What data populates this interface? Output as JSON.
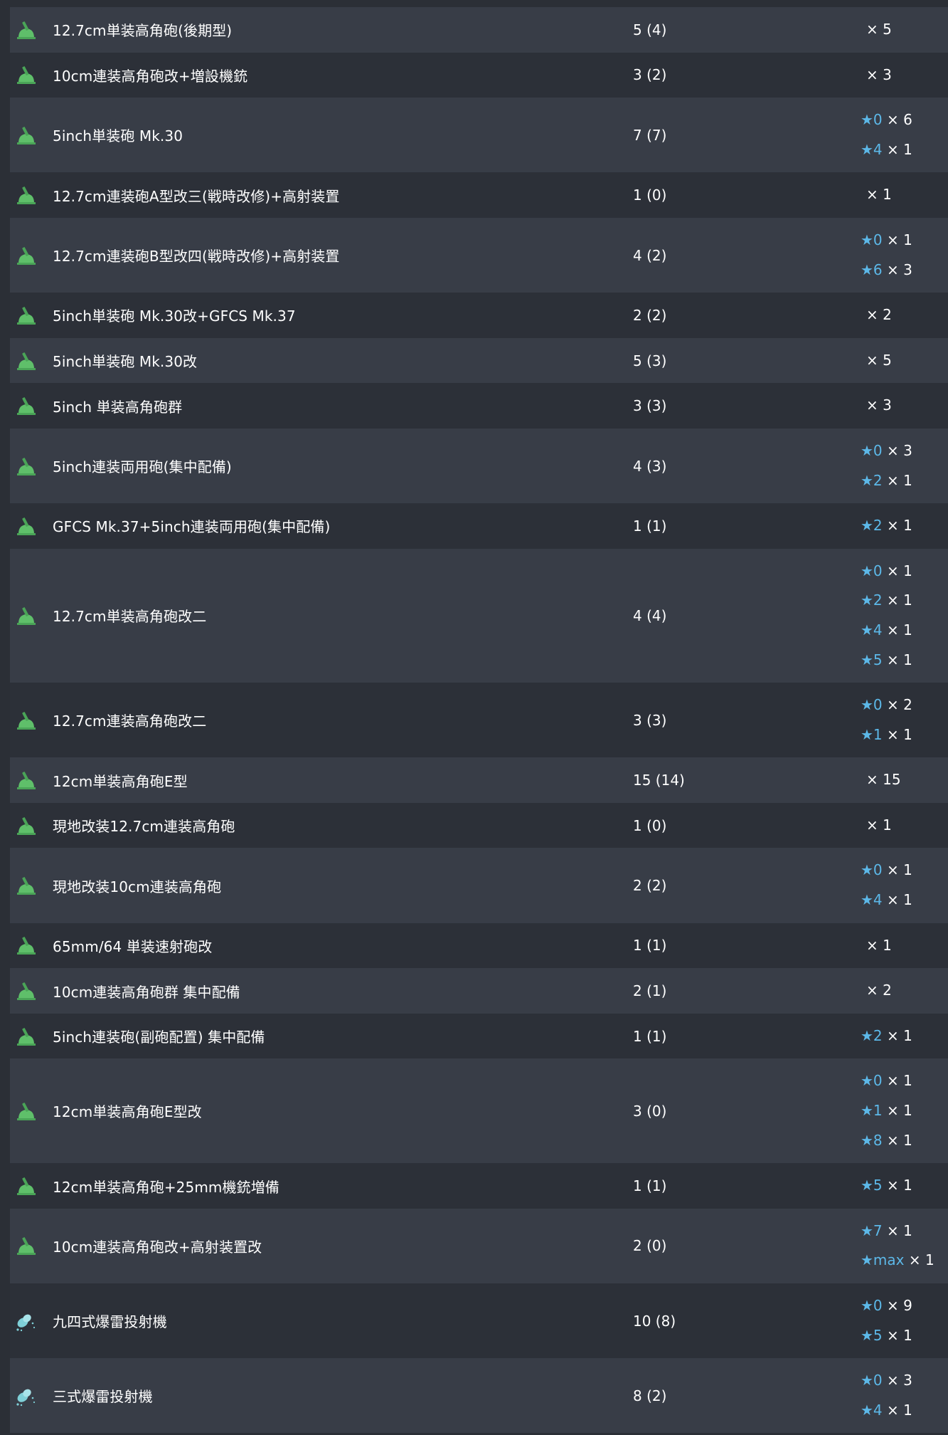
{
  "colors": {
    "row_odd": "#383d47",
    "row_even": "#2c3038",
    "star_blue": "#5cb8e8",
    "gun_icon_green": "#5fbf6a",
    "torpedo_icon_cyan": "#7fd0d8"
  },
  "rows": [
    {
      "icon": "gun-icon",
      "name": "12.7cm単装高角砲(後期型)",
      "count": "5 (4)",
      "stars": [
        {
          "level": "",
          "times": "× 5"
        }
      ]
    },
    {
      "icon": "gun-icon",
      "name": "10cm連装高角砲改+増設機銃",
      "count": "3 (2)",
      "stars": [
        {
          "level": "",
          "times": "× 3"
        }
      ]
    },
    {
      "icon": "gun-icon",
      "name": "5inch単装砲 Mk.30",
      "count": "7 (7)",
      "stars": [
        {
          "level": "★0",
          "times": " × 6"
        },
        {
          "level": "★4",
          "times": " × 1"
        }
      ]
    },
    {
      "icon": "gun-icon",
      "name": "12.7cm連装砲A型改三(戦時改修)+高射装置",
      "count": "1 (0)",
      "stars": [
        {
          "level": "",
          "times": "× 1"
        }
      ]
    },
    {
      "icon": "gun-icon",
      "name": "12.7cm連装砲B型改四(戦時改修)+高射装置",
      "count": "4 (2)",
      "stars": [
        {
          "level": "★0",
          "times": " × 1"
        },
        {
          "level": "★6",
          "times": " × 3"
        }
      ]
    },
    {
      "icon": "gun-icon",
      "name": "5inch単装砲 Mk.30改+GFCS Mk.37",
      "count": "2 (2)",
      "stars": [
        {
          "level": "",
          "times": "× 2"
        }
      ]
    },
    {
      "icon": "gun-icon",
      "name": "5inch単装砲 Mk.30改",
      "count": "5 (3)",
      "stars": [
        {
          "level": "",
          "times": "× 5"
        }
      ]
    },
    {
      "icon": "gun-icon",
      "name": "5inch 単装高角砲群",
      "count": "3 (3)",
      "stars": [
        {
          "level": "",
          "times": "× 3"
        }
      ]
    },
    {
      "icon": "gun-icon",
      "name": "5inch連装両用砲(集中配備)",
      "count": "4 (3)",
      "stars": [
        {
          "level": "★0",
          "times": " × 3"
        },
        {
          "level": "★2",
          "times": " × 1"
        }
      ]
    },
    {
      "icon": "gun-icon",
      "name": "GFCS Mk.37+5inch連装両用砲(集中配備)",
      "count": "1 (1)",
      "stars": [
        {
          "level": "★2",
          "times": " × 1"
        }
      ]
    },
    {
      "icon": "gun-icon",
      "name": "12.7cm単装高角砲改二",
      "count": "4 (4)",
      "stars": [
        {
          "level": "★0",
          "times": " × 1"
        },
        {
          "level": "★2",
          "times": " × 1"
        },
        {
          "level": "★4",
          "times": " × 1"
        },
        {
          "level": "★5",
          "times": " × 1"
        }
      ]
    },
    {
      "icon": "gun-icon",
      "name": "12.7cm連装高角砲改二",
      "count": "3 (3)",
      "stars": [
        {
          "level": "★0",
          "times": " × 2"
        },
        {
          "level": "★1",
          "times": " × 1"
        }
      ]
    },
    {
      "icon": "gun-icon",
      "name": "12cm単装高角砲E型",
      "count": "15 (14)",
      "stars": [
        {
          "level": "",
          "times": "× 15"
        }
      ]
    },
    {
      "icon": "gun-icon",
      "name": "現地改装12.7cm連装高角砲",
      "count": "1 (0)",
      "stars": [
        {
          "level": "",
          "times": "× 1"
        }
      ]
    },
    {
      "icon": "gun-icon",
      "name": "現地改装10cm連装高角砲",
      "count": "2 (2)",
      "stars": [
        {
          "level": "★0",
          "times": " × 1"
        },
        {
          "level": "★4",
          "times": " × 1"
        }
      ]
    },
    {
      "icon": "gun-icon",
      "name": "65mm/64 単装速射砲改",
      "count": "1 (1)",
      "stars": [
        {
          "level": "",
          "times": "× 1"
        }
      ]
    },
    {
      "icon": "gun-icon",
      "name": "10cm連装高角砲群 集中配備",
      "count": "2 (1)",
      "stars": [
        {
          "level": "",
          "times": "× 2"
        }
      ]
    },
    {
      "icon": "gun-icon",
      "name": "5inch連装砲(副砲配置) 集中配備",
      "count": "1 (1)",
      "stars": [
        {
          "level": "★2",
          "times": " × 1"
        }
      ]
    },
    {
      "icon": "gun-icon",
      "name": "12cm単装高角砲E型改",
      "count": "3 (0)",
      "stars": [
        {
          "level": "★0",
          "times": " × 1"
        },
        {
          "level": "★1",
          "times": " × 1"
        },
        {
          "level": "★8",
          "times": " × 1"
        }
      ]
    },
    {
      "icon": "gun-icon",
      "name": "12cm単装高角砲+25mm機銃増備",
      "count": "1 (1)",
      "stars": [
        {
          "level": "★5",
          "times": " × 1"
        }
      ]
    },
    {
      "icon": "gun-icon",
      "name": "10cm連装高角砲改+高射装置改",
      "count": "2 (0)",
      "stars": [
        {
          "level": "★7",
          "times": " × 1"
        },
        {
          "level": "★max",
          "times": " × 1"
        }
      ]
    },
    {
      "icon": "depth-charge-icon",
      "name": "九四式爆雷投射機",
      "count": "10 (8)",
      "stars": [
        {
          "level": "★0",
          "times": " × 9"
        },
        {
          "level": "★5",
          "times": " × 1"
        }
      ]
    },
    {
      "icon": "depth-charge-icon",
      "name": "三式爆雷投射機",
      "count": "8 (2)",
      "stars": [
        {
          "level": "★0",
          "times": " × 3"
        },
        {
          "level": "★4",
          "times": " × 1"
        }
      ]
    }
  ]
}
